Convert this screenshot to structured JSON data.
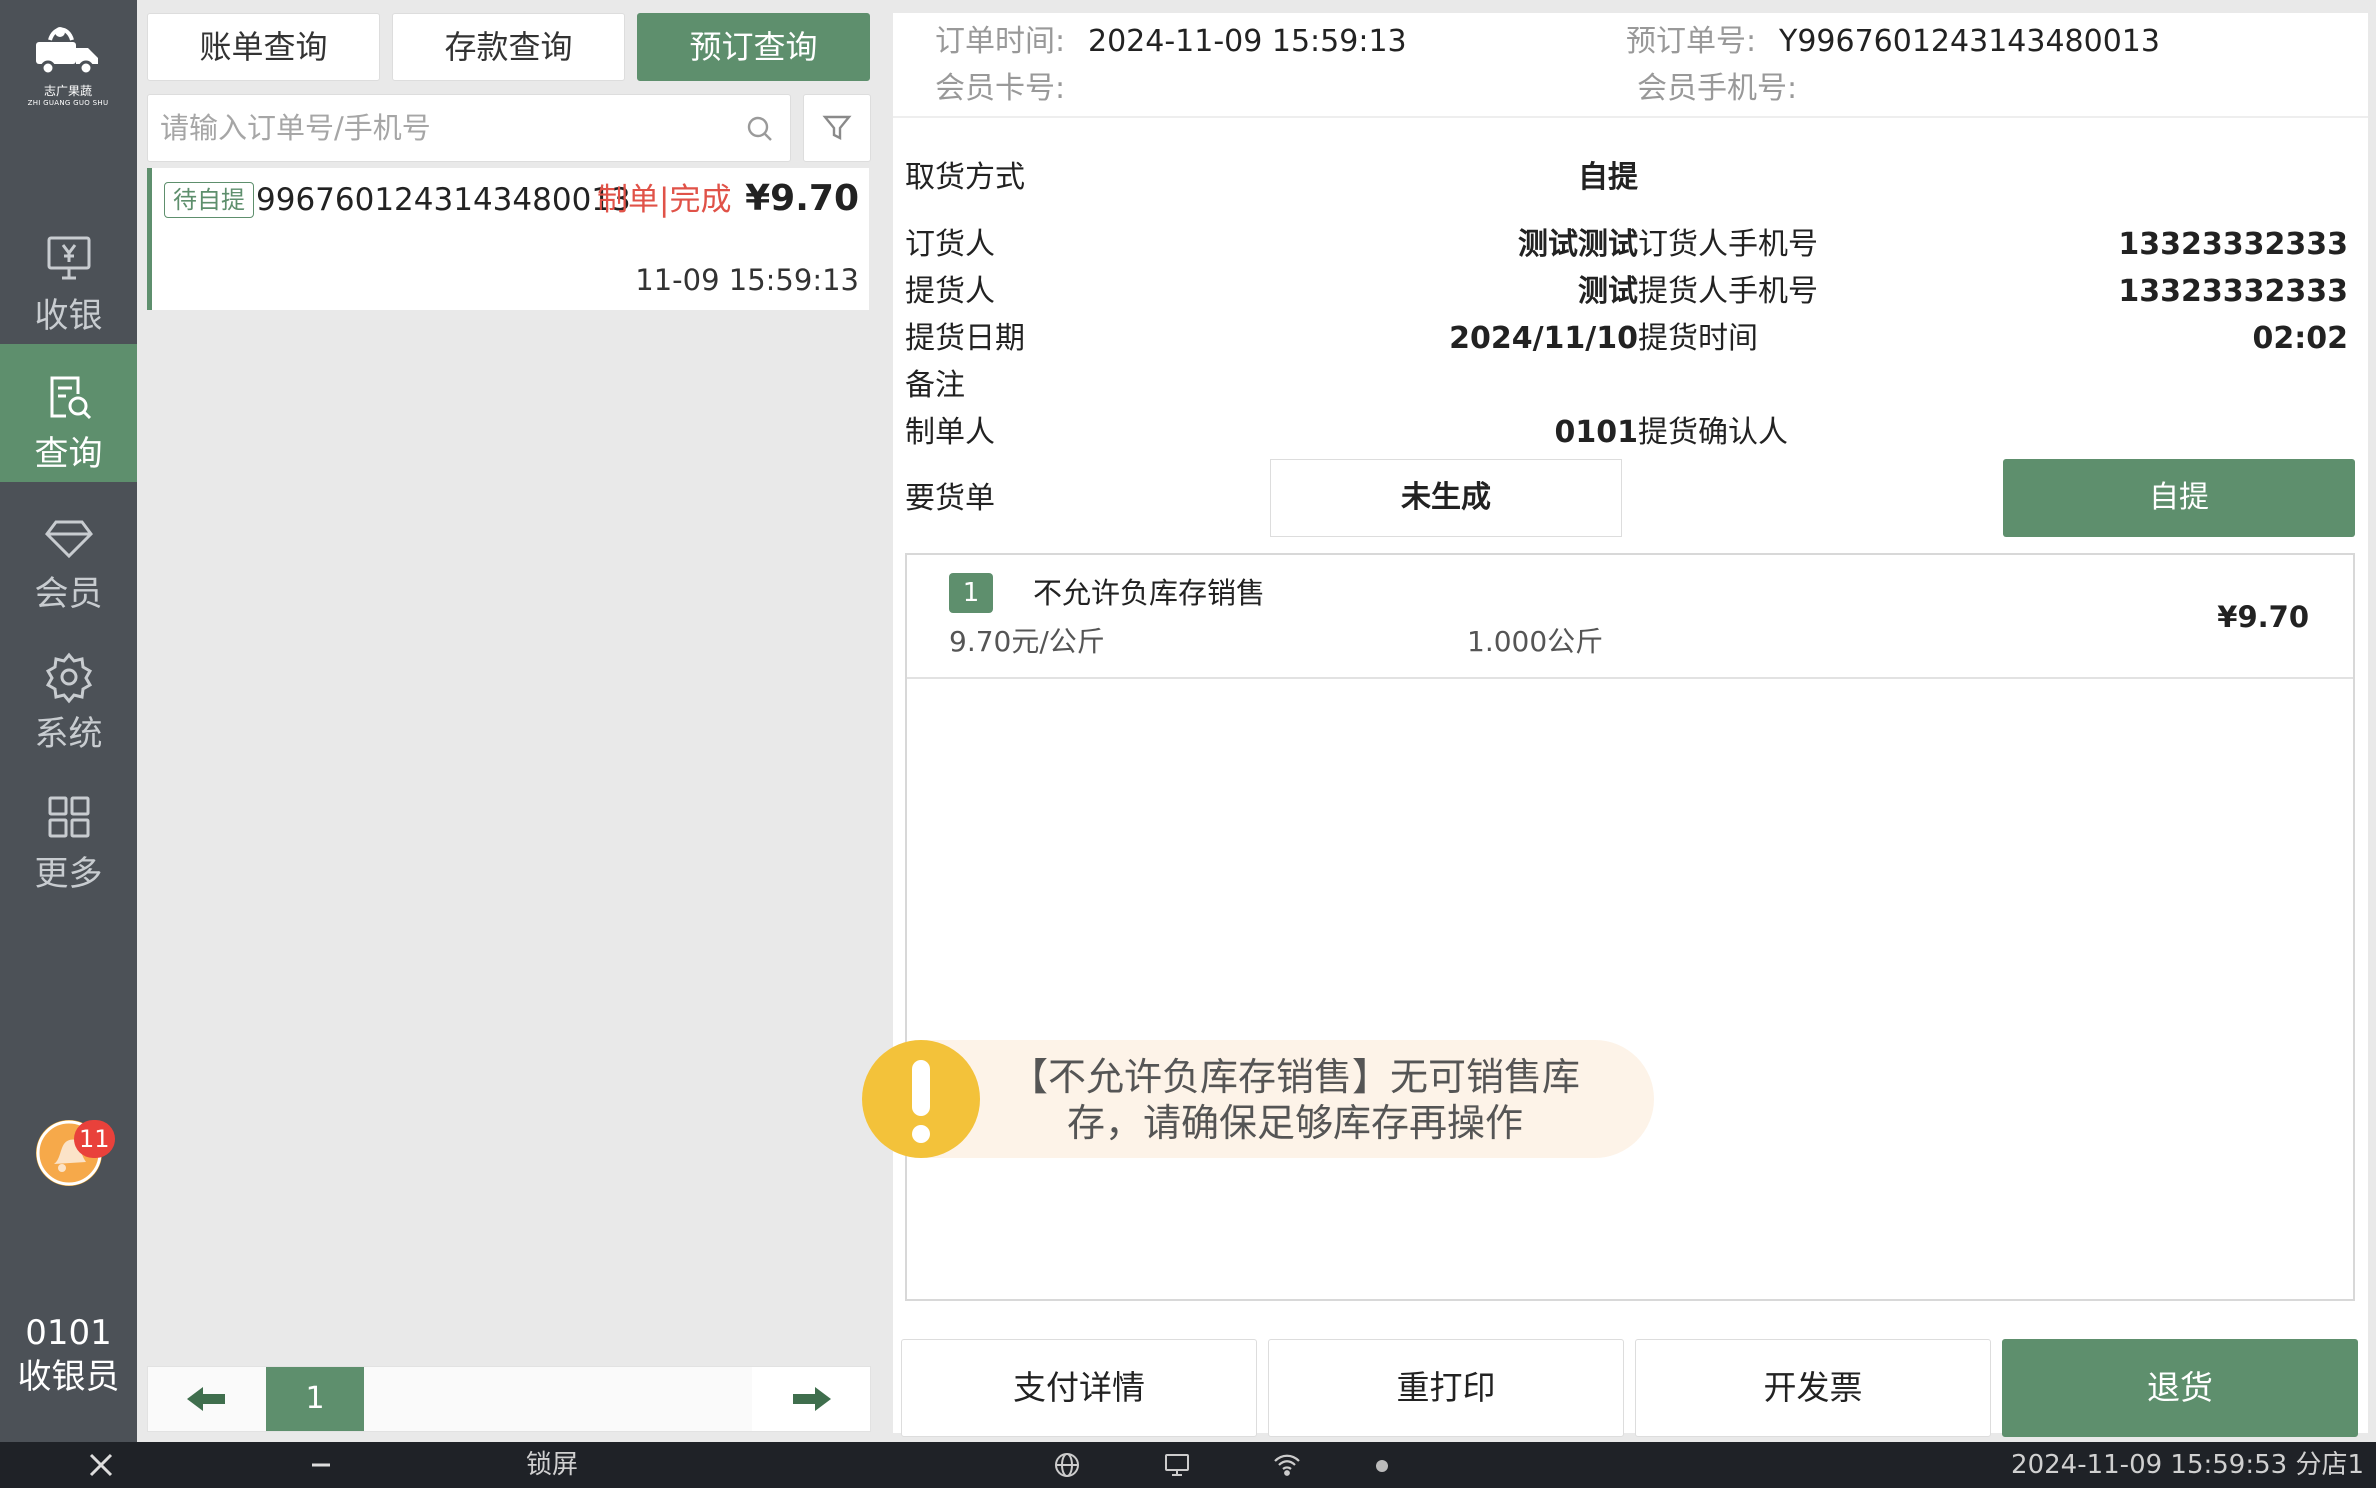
{
  "brand": {
    "name_cn": "志广果蔬",
    "name_en": "ZHI GUANG GUO SHU"
  },
  "sidebar": {
    "items": [
      {
        "label": "收银"
      },
      {
        "label": "查询"
      },
      {
        "label": "会员"
      },
      {
        "label": "系统"
      },
      {
        "label": "更多"
      }
    ],
    "active_index": 1,
    "notification_count": "11",
    "cashier_id": "0101",
    "cashier_role": "收银员"
  },
  "tabs": [
    {
      "label": "账单查询"
    },
    {
      "label": "存款查询"
    },
    {
      "label": "预订查询"
    }
  ],
  "active_tab": 2,
  "search": {
    "placeholder": "请输入订单号/手机号",
    "value": ""
  },
  "orders": [
    {
      "tag": "待自提",
      "number": "9967601243143480013",
      "status": "制单|完成",
      "amount": "¥9.70",
      "time": "11-09 15:59:13"
    }
  ],
  "pager": {
    "current_page": "1"
  },
  "detail": {
    "header": {
      "order_time_label": "订单时间:",
      "order_time": "2024-11-09 15:59:13",
      "reservation_no_label": "预订单号:",
      "reservation_no": "Y9967601243143480013",
      "member_card_label": "会员卡号:",
      "member_card": "",
      "member_phone_label": "会员手机号:",
      "member_phone": ""
    },
    "fields": {
      "pickup_method_label": "取货方式",
      "pickup_method": "自提",
      "orderer_label": "订货人",
      "orderer": "测试测试",
      "orderer_phone_label": "订货人手机号",
      "orderer_phone": "13323332333",
      "picker_label": "提货人",
      "picker": "测试",
      "picker_phone_label": "提货人手机号",
      "picker_phone": "13323332333",
      "pickup_date_label": "提货日期",
      "pickup_date": "2024/11/10",
      "pickup_time_label": "提货时间",
      "pickup_time": "02:02",
      "remark_label": "备注",
      "remark": "",
      "creator_label": "制单人",
      "creator": "0101",
      "confirmer_label": "提货确认人",
      "confirmer": "",
      "requisition_label": "要货单",
      "requisition_value": "未生成",
      "pickup_button": "自提"
    },
    "items": [
      {
        "index": "1",
        "name": "不允许负库存销售",
        "unit_price": "9.70元/公斤",
        "quantity": "1.000公斤",
        "amount": "¥9.70"
      }
    ],
    "actions": {
      "payment_details": "支付详情",
      "reprint": "重打印",
      "invoice": "开发票",
      "return": "退货"
    }
  },
  "toast": {
    "line1": "【不允许负库存销售】无可销售库",
    "line2": "存，请确保足够库存再操作"
  },
  "taskbar": {
    "lock_label": "锁屏",
    "clock": "2024-11-09 15:59:53",
    "store": "分店1"
  },
  "colors": {
    "primary_green": "#5e8f6d",
    "sidebar_bg": "#4c5157",
    "warning_yellow": "#f3c23a",
    "status_red": "#e05248"
  }
}
